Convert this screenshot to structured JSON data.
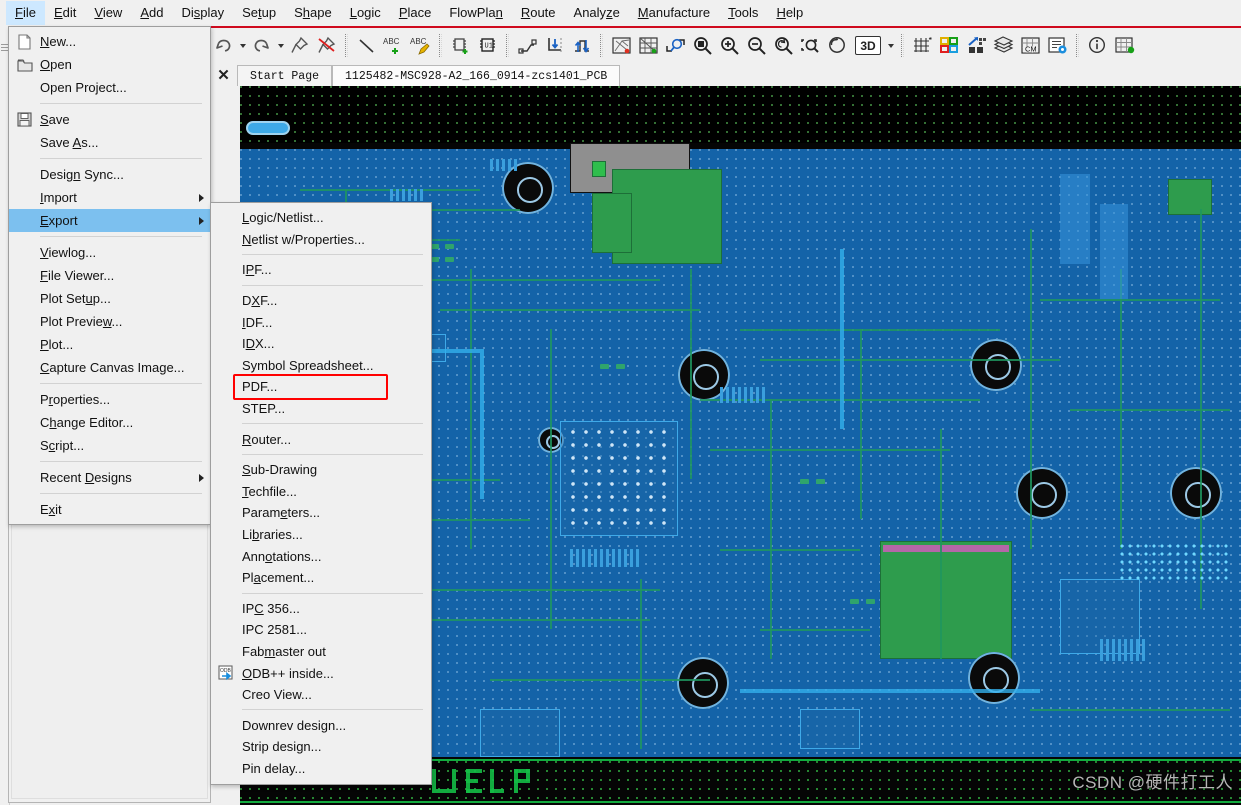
{
  "menubar": {
    "items": [
      {
        "label": "File",
        "accel": "F",
        "active": true
      },
      {
        "label": "Edit",
        "accel": "E"
      },
      {
        "label": "View",
        "accel": "V"
      },
      {
        "label": "Add",
        "accel": "A"
      },
      {
        "label": "Display",
        "accel": "s"
      },
      {
        "label": "Setup",
        "accel": "t"
      },
      {
        "label": "Shape",
        "accel": "h"
      },
      {
        "label": "Logic",
        "accel": "L"
      },
      {
        "label": "Place",
        "accel": "P"
      },
      {
        "label": "FlowPlan",
        "accel": "n"
      },
      {
        "label": "Route",
        "accel": "R"
      },
      {
        "label": "Analyze",
        "accel": "z"
      },
      {
        "label": "Manufacture",
        "accel": "M"
      },
      {
        "label": "Tools",
        "accel": "T"
      },
      {
        "label": "Help",
        "accel": "H"
      }
    ]
  },
  "toolbar": {
    "buttons": [
      {
        "name": "undo-icon",
        "tip": "Undo"
      },
      {
        "name": "undo-dropdown-caret",
        "tip": "Undo history"
      },
      {
        "name": "redo-icon",
        "tip": "Redo"
      },
      {
        "name": "redo-dropdown-caret",
        "tip": "Redo history"
      },
      {
        "name": "pin-icon",
        "tip": "Save as pinned"
      },
      {
        "name": "unpin-icon",
        "tip": "Remove pin"
      },
      {
        "name": "add-line-icon",
        "tip": "Add Line"
      },
      {
        "name": "add-text-icon",
        "tip": "Add Text"
      },
      {
        "name": "edit-text-icon",
        "tip": "Edit Text"
      },
      {
        "name": "place-component-icon",
        "tip": "Place Manual"
      },
      {
        "name": "show-element-icon",
        "tip": "Show Element"
      },
      {
        "name": "add-connect-icon",
        "tip": "Add Connect"
      },
      {
        "name": "slide-down-icon",
        "tip": "Slide"
      },
      {
        "name": "slide-up-icon",
        "tip": "Delay Tune"
      },
      {
        "name": "ratsnest-icon",
        "tip": "Show Rats"
      },
      {
        "name": "unrats-icon",
        "tip": "Unrats All"
      },
      {
        "name": "zoom-by-points-icon",
        "tip": "Zoom by Points"
      },
      {
        "name": "zoom-fit-icon",
        "tip": "Zoom Fit"
      },
      {
        "name": "zoom-in-icon",
        "tip": "Zoom In"
      },
      {
        "name": "zoom-out-icon",
        "tip": "Zoom Out"
      },
      {
        "name": "zoom-previous-icon",
        "tip": "Zoom Previous"
      },
      {
        "name": "zoom-world-icon",
        "tip": "Zoom World"
      },
      {
        "name": "refresh-icon",
        "tip": "Redraw"
      },
      {
        "name": "3d-view-button",
        "tip": "3D Canvas",
        "label": "3D"
      },
      {
        "name": "3d-dropdown-caret",
        "tip": "3D options"
      },
      {
        "name": "grid-toggle-icon",
        "tip": "Grid Toggle"
      },
      {
        "name": "color-layers-icon",
        "tip": "Color/Visibility"
      },
      {
        "name": "subclass-icon",
        "tip": "Subclass"
      },
      {
        "name": "layers-icon",
        "tip": "Layers"
      },
      {
        "name": "constraint-manager-icon",
        "tip": "Constraint Manager",
        "label": "CM"
      },
      {
        "name": "properties-icon",
        "tip": "Property Editor"
      },
      {
        "name": "info-icon",
        "tip": "Show Info"
      },
      {
        "name": "table-icon",
        "tip": "Table"
      }
    ]
  },
  "tabs": {
    "close_glyph": "✕",
    "items": [
      {
        "label": "Start Page",
        "selected": false
      },
      {
        "label": "1125482-MSC928-A2_166_0914-zcs1401_PCB",
        "selected": true
      }
    ]
  },
  "file_menu": {
    "items": [
      {
        "label": "New...",
        "accel": "N",
        "icon": "new-file-icon"
      },
      {
        "label": "Open",
        "accel": "O",
        "icon": "open-folder-icon"
      },
      {
        "label": "Open Project...",
        "accel": "",
        "icon": ""
      },
      {
        "sep": true
      },
      {
        "label": "Save",
        "accel": "S",
        "icon": "save-disk-icon"
      },
      {
        "label": "Save As...",
        "accel": "A",
        "icon": ""
      },
      {
        "sep": true
      },
      {
        "label": "Design Sync...",
        "accel": "n",
        "icon": ""
      },
      {
        "label": "Import",
        "accel": "I",
        "icon": "",
        "submenu": true
      },
      {
        "label": "Export",
        "accel": "E",
        "icon": "",
        "submenu": true,
        "highlighted": true
      },
      {
        "sep": true
      },
      {
        "label": "Viewlog...",
        "accel": "V",
        "icon": ""
      },
      {
        "label": "File Viewer...",
        "accel": "F",
        "icon": ""
      },
      {
        "label": "Plot Setup...",
        "accel": "u",
        "icon": ""
      },
      {
        "label": "Plot Preview...",
        "accel": "w",
        "icon": ""
      },
      {
        "label": "Plot...",
        "accel": "P",
        "icon": ""
      },
      {
        "label": "Capture Canvas Image...",
        "accel": "C",
        "icon": ""
      },
      {
        "sep": true
      },
      {
        "label": "Properties...",
        "accel": "r",
        "icon": ""
      },
      {
        "label": "Change Editor...",
        "accel": "h",
        "icon": ""
      },
      {
        "label": "Script...",
        "accel": "c",
        "icon": ""
      },
      {
        "sep": true
      },
      {
        "label": "Recent Designs",
        "accel": "D",
        "icon": "",
        "submenu": true
      },
      {
        "sep": true
      },
      {
        "label": "Exit",
        "accel": "x",
        "icon": ""
      }
    ]
  },
  "export_submenu": {
    "items": [
      {
        "label": "Logic/Netlist...",
        "accel": "L",
        "icon": ""
      },
      {
        "label": "Netlist w/Properties...",
        "accel": "N",
        "icon": ""
      },
      {
        "sep": true
      },
      {
        "label": "IPF...",
        "accel": "P",
        "icon": ""
      },
      {
        "sep": true
      },
      {
        "label": "DXF...",
        "accel": "X",
        "icon": ""
      },
      {
        "label": "IDF...",
        "accel": "I",
        "icon": ""
      },
      {
        "label": "IDX...",
        "accel": "D",
        "icon": ""
      },
      {
        "label": "Symbol Spreadsheet...",
        "accel": "",
        "icon": ""
      },
      {
        "label": "PDF...",
        "accel": "",
        "icon": "",
        "boxed": true
      },
      {
        "label": "STEP...",
        "accel": "",
        "icon": ""
      },
      {
        "sep": true
      },
      {
        "label": "Router...",
        "accel": "R",
        "icon": ""
      },
      {
        "sep": true
      },
      {
        "label": "Sub-Drawing",
        "accel": "S",
        "icon": ""
      },
      {
        "label": "Techfile...",
        "accel": "T",
        "icon": ""
      },
      {
        "label": "Parameters...",
        "accel": "e",
        "icon": ""
      },
      {
        "label": "Libraries...",
        "accel": "b",
        "icon": ""
      },
      {
        "label": "Annotations...",
        "accel": "o",
        "icon": ""
      },
      {
        "label": "Placement...",
        "accel": "a",
        "icon": ""
      },
      {
        "sep": true
      },
      {
        "label": "IPC 356...",
        "accel": "C",
        "icon": ""
      },
      {
        "label": "IPC 2581...",
        "accel": "",
        "icon": ""
      },
      {
        "label": "Fabmaster out",
        "accel": "m",
        "icon": ""
      },
      {
        "label": "ODB++ inside...",
        "accel": "O",
        "icon": "odb-export-icon"
      },
      {
        "label": "Creo View...",
        "accel": "",
        "icon": ""
      },
      {
        "sep": true
      },
      {
        "label": "Downrev design...",
        "accel": "",
        "icon": ""
      },
      {
        "label": "Strip design...",
        "accel": "",
        "icon": ""
      },
      {
        "label": "Pin delay...",
        "accel": "",
        "icon": ""
      }
    ]
  },
  "canvas": {
    "watermark": "CSDN @硬件打工人",
    "background_color": "#000000",
    "board_color": "#1463a8",
    "grid_dot_color": "#78ff78",
    "trace_color": "#1e965f",
    "highlight_color": "#f00000"
  },
  "colors": {
    "menu_highlight": "#7cc0ef",
    "menubar_active": "#cde8ff",
    "accent_red": "#cf0a1e",
    "chrome": "#f0f0f0"
  }
}
